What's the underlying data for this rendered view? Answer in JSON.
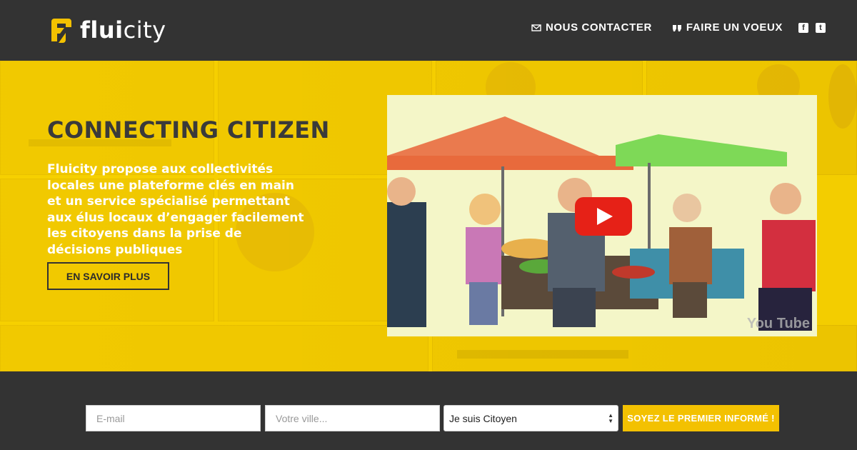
{
  "header": {
    "logo_bold": "flui",
    "logo_light": "city",
    "nav": [
      {
        "label": "NOUS CONTACTER",
        "icon": "envelope-icon"
      },
      {
        "label": "FAIRE UN VOEUX",
        "icon": "quote-icon"
      }
    ],
    "social": [
      {
        "icon": "facebook-icon",
        "glyph": "f"
      },
      {
        "icon": "twitter-icon",
        "glyph": "t"
      }
    ]
  },
  "hero": {
    "title": "CONNECTING CITIZEN",
    "text": "Fluicity propose aux collectivités locales une plateforme clés en main et un service spécialisé permettant aux élus locaux d’engager facilement les citoyens dans la prise de décisions publiques",
    "button": "EN SAVOIR PLUS"
  },
  "video": {
    "play_icon": "youtube-play-icon",
    "watermark": "You Tube"
  },
  "form": {
    "email_placeholder": "E-mail",
    "city_placeholder": "Votre ville...",
    "select_value": "Je suis Citoyen",
    "submit": "SOYEZ LE PREMIER INFORMÉ !"
  },
  "colors": {
    "accent": "#f3c101",
    "dark": "#333333",
    "youtube_red": "#e62117"
  }
}
